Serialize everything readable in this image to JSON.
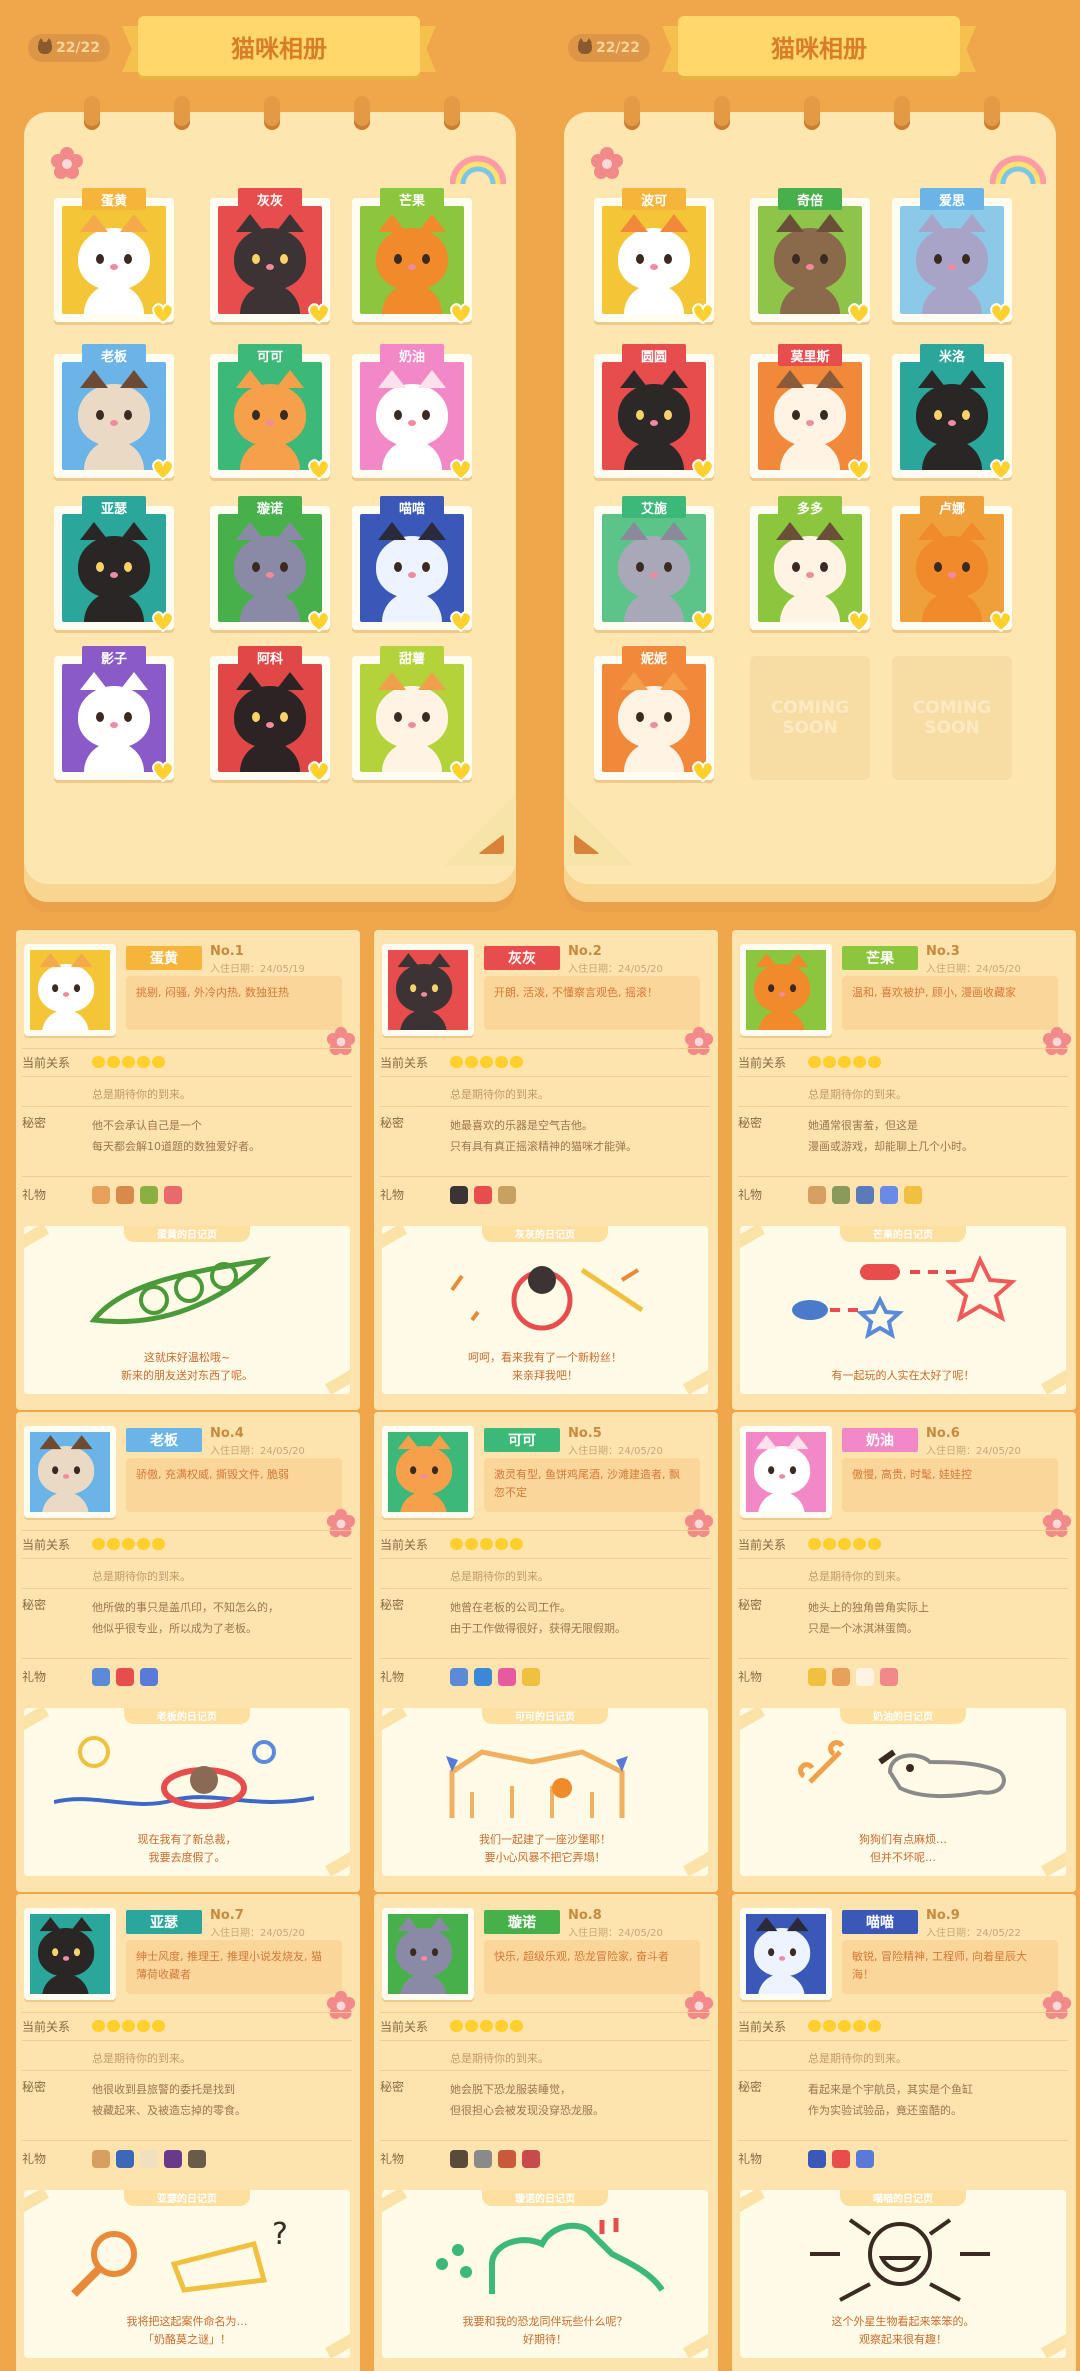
{
  "album": {
    "counter": "22/22",
    "title": "猫咪相册",
    "coming_soon": "COMING SOON",
    "left_cats": [
      {
        "name": "蛋黄",
        "tag": "#f7b43a",
        "bg": "#f4c637",
        "fur": "#ffffff",
        "ear": "#f4a94b"
      },
      {
        "name": "灰灰",
        "tag": "#e84d4d",
        "bg": "#e84d4d",
        "fur": "#3c3434",
        "ear": "#3c3434"
      },
      {
        "name": "芒果",
        "tag": "#8cc63f",
        "bg": "#8cc63f",
        "fur": "#f08a2a",
        "ear": "#f08a2a"
      },
      {
        "name": "老板",
        "tag": "#6ab4e8",
        "bg": "#6ab4e8",
        "fur": "#ead9c4",
        "ear": "#6e4a34"
      },
      {
        "name": "可可",
        "tag": "#3cb878",
        "bg": "#3cb878",
        "fur": "#f6a04c",
        "ear": "#f6a04c"
      },
      {
        "name": "奶油",
        "tag": "#f388c6",
        "bg": "#f388c6",
        "fur": "#ffffff",
        "ear": "#ffe1ee"
      },
      {
        "name": "亚瑟",
        "tag": "#2aa69a",
        "bg": "#2aa69a",
        "fur": "#2a2626",
        "ear": "#2a2626"
      },
      {
        "name": "璇诺",
        "tag": "#48b04a",
        "bg": "#48b04a",
        "fur": "#8a8aa6",
        "ear": "#8a8aa6"
      },
      {
        "name": "喵喵",
        "tag": "#3a58b8",
        "bg": "#3a58b8",
        "fur": "#eef4ff",
        "ear": "#2a2a3a"
      },
      {
        "name": "影子",
        "tag": "#8a5ac8",
        "bg": "#8a5ac8",
        "fur": "#ffffff",
        "ear": "#ffffff"
      },
      {
        "name": "阿科",
        "tag": "#e04848",
        "bg": "#e04848",
        "fur": "#2c2424",
        "ear": "#2c2424"
      },
      {
        "name": "甜薯",
        "tag": "#b4d23a",
        "bg": "#b4d23a",
        "fur": "#fff4e4",
        "ear": "#f0a04a"
      }
    ],
    "right_cats": [
      {
        "name": "波可",
        "tag": "#f7b43a",
        "bg": "#f4c637",
        "fur": "#ffffff",
        "ear": "#f08a3a"
      },
      {
        "name": "奇倍",
        "tag": "#48b04a",
        "bg": "#8fc44a",
        "fur": "#8a6a4a",
        "ear": "#6a5038"
      },
      {
        "name": "爱思",
        "tag": "#6ab4e8",
        "bg": "#8cc8e8",
        "fur": "#a8a4c8",
        "ear": "#a8a4c8"
      },
      {
        "name": "圆圆",
        "tag": "#e84d4d",
        "bg": "#e84d4d",
        "fur": "#2c2828",
        "ear": "#2c2828"
      },
      {
        "name": "莫里斯",
        "tag": "#e84d4d",
        "bg": "#f08a3a",
        "fur": "#fff4e4",
        "ear": "#8a5a3a"
      },
      {
        "name": "米洛",
        "tag": "#2aa69a",
        "bg": "#2aa69a",
        "fur": "#2a2626",
        "ear": "#2a2626"
      },
      {
        "name": "艾旎",
        "tag": "#3cb878",
        "bg": "#5cc488",
        "fur": "#a8a8b8",
        "ear": "#8a8a9a"
      },
      {
        "name": "多多",
        "tag": "#8cc63f",
        "bg": "#8cc63f",
        "fur": "#fff4e4",
        "ear": "#6a5038"
      },
      {
        "name": "卢娜",
        "tag": "#f0a03a",
        "bg": "#f0a03a",
        "fur": "#f08a2a",
        "ear": "#f08a2a"
      },
      {
        "name": "妮妮",
        "tag": "#f08a3a",
        "bg": "#f08a3a",
        "fur": "#fff4e4",
        "ear": "#f4a04a"
      }
    ]
  },
  "labels": {
    "relation": "当前关系",
    "secret": "秘密",
    "gift": "礼物",
    "hope": "总是期待你的到来。"
  },
  "profiles": [
    {
      "name": "蛋黄",
      "no": "No.1",
      "date": "入住日期：24/05/19",
      "tag": "#f7b43a",
      "bg": "#f4c637",
      "fur": "#ffffff",
      "ear": "#f4a94b",
      "traits": "挑剔, 闷骚, 外冷内热, 数独狂热",
      "secret1": "他不会承认自己是一个",
      "secret2": "每天都会解10道题的数独爱好者。",
      "diary": "蛋黄的日记页",
      "cap1": "这就床好温松哦~",
      "cap2": "新来的朋友送对东西了呢。",
      "gifts": [
        "#e8a05a",
        "#d88a4a",
        "#8ab040",
        "#e86a6a"
      ]
    },
    {
      "name": "灰灰",
      "no": "No.2",
      "date": "入住日期：24/05/20",
      "tag": "#e84d4d",
      "bg": "#e84d4d",
      "fur": "#3c3434",
      "ear": "#3c3434",
      "traits": "开朗, 活泼, 不懂察言观色, 摇滚！",
      "secret1": "她最喜欢的乐器是空气吉他。",
      "secret2": "只有具有真正摇滚精神的猫咪才能弹。",
      "diary": "灰灰的日记页",
      "cap1": "呵呵，看来我有了一个新粉丝！",
      "cap2": "来亲拜我吧！",
      "gifts": [
        "#3c3434",
        "#e84d4d",
        "#c8a060"
      ]
    },
    {
      "name": "芒果",
      "no": "No.3",
      "date": "入住日期：24/05/20",
      "tag": "#8cc63f",
      "bg": "#8cc63f",
      "fur": "#f08a2a",
      "ear": "#f08a2a",
      "traits": "温和, 喜欢被护, 顾小, 漫画收藏家",
      "secret1": "她通常很害羞，但这是",
      "secret2": "漫画或游戏，却能聊上几个小时。",
      "diary": "芒果的日记页",
      "cap1": "有一起玩的人实在太好了呢！",
      "cap2": "",
      "gifts": [
        "#d8a060",
        "#8a9a5a",
        "#5a7ab8",
        "#6a8ae8",
        "#f0c040"
      ]
    },
    {
      "name": "老板",
      "no": "No.4",
      "date": "入住日期：24/05/20",
      "tag": "#6ab4e8",
      "bg": "#6ab4e8",
      "fur": "#ead9c4",
      "ear": "#6e4a34",
      "traits": "骄傲, 充满权威, 撕毁文件, 脆弱",
      "secret1": "他所做的事只是盖爪印，不知怎么的，",
      "secret2": "他似乎很专业，所以成为了老板。",
      "diary": "老板的日记页",
      "cap1": "现在我有了新总裁，",
      "cap2": "我要去度假了。",
      "gifts": [
        "#5a8ad8",
        "#e84d4d",
        "#5a7ad8"
      ]
    },
    {
      "name": "可可",
      "no": "No.5",
      "date": "入住日期：24/05/20",
      "tag": "#3cb878",
      "bg": "#3cb878",
      "fur": "#f6a04c",
      "ear": "#f6a04c",
      "traits": "激灵有型, 鱼饼鸡尾酒, 沙滩建造者, 飘忽不定",
      "secret1": "她曾在老板的公司工作。",
      "secret2": "由于工作做得很好，获得无限假期。",
      "diary": "可可的日记页",
      "cap1": "我们一起建了一座沙堡耶！",
      "cap2": "要小心风暴不把它弄塌！",
      "gifts": [
        "#5a8ad8",
        "#3c88d8",
        "#e85aa0",
        "#f0c040"
      ]
    },
    {
      "name": "奶油",
      "no": "No.6",
      "date": "入住日期：24/05/20",
      "tag": "#f388c6",
      "bg": "#f388c6",
      "fur": "#ffffff",
      "ear": "#ffe1ee",
      "traits": "傲慢, 高贵, 时髦, 娃娃控",
      "secret1": "她头上的独角兽角实际上",
      "secret2": "只是一个冰淇淋蛋筒。",
      "diary": "奶油的日记页",
      "cap1": "狗狗们有点麻烦…",
      "cap2": "但并不坏呢…",
      "gifts": [
        "#f0c040",
        "#e8a05a",
        "#fff4e4",
        "#f08a8a"
      ]
    },
    {
      "name": "亚瑟",
      "no": "No.7",
      "date": "入住日期：24/05/20",
      "tag": "#2aa69a",
      "bg": "#2aa69a",
      "fur": "#2a2626",
      "ear": "#2a2626",
      "traits": "绅士风度, 推理王, 推理小说发烧友, 猫薄荷收藏者",
      "secret1": "他很收到县旅警的委托是找到",
      "secret2": "被藏起来、及被造忘掉的零食。",
      "diary": "亚瑟的日记页",
      "cap1": "我将把这起案件命名为…",
      "cap2": "「奶酪莫之谜」！",
      "gifts": [
        "#d8a060",
        "#3c68b8",
        "#f0e0c0",
        "#6a3a8a",
        "#6a5a4a"
      ]
    },
    {
      "name": "璇诺",
      "no": "No.8",
      "date": "入住日期：24/05/20",
      "tag": "#48b04a",
      "bg": "#48b04a",
      "fur": "#8a8aa6",
      "ear": "#8a8aa6",
      "traits": "快乐, 超级乐观, 恐龙冒险家, 奋斗者",
      "secret1": "她会脱下恐龙服装睡觉，",
      "secret2": "但很担心会被发现没穿恐龙服。",
      "diary": "璇诺的日记页",
      "cap1": "我要和我的恐龙同伴玩些什么呢？",
      "cap2": "好期待！",
      "gifts": [
        "#5a4a3a",
        "#8a8a8a",
        "#c85a3a",
        "#c84a4a"
      ]
    },
    {
      "name": "喵喵",
      "no": "No.9",
      "date": "入住日期：24/05/22",
      "tag": "#3a58b8",
      "bg": "#3a58b8",
      "fur": "#eef4ff",
      "ear": "#2a2a3a",
      "traits": "敏锐, 冒险精神, 工程师, 向着星辰大海！",
      "secret1": "看起来是个宇航员，其实是个鱼缸",
      "secret2": "作为实验试验品，竟还蛮酷的。",
      "diary": "喵喵的日记页",
      "cap1": "这个外星生物看起来笨笨的。",
      "cap2": "观察起来很有趣！",
      "gifts": [
        "#3a58b8",
        "#e84d4d",
        "#5a7ad8"
      ]
    }
  ]
}
